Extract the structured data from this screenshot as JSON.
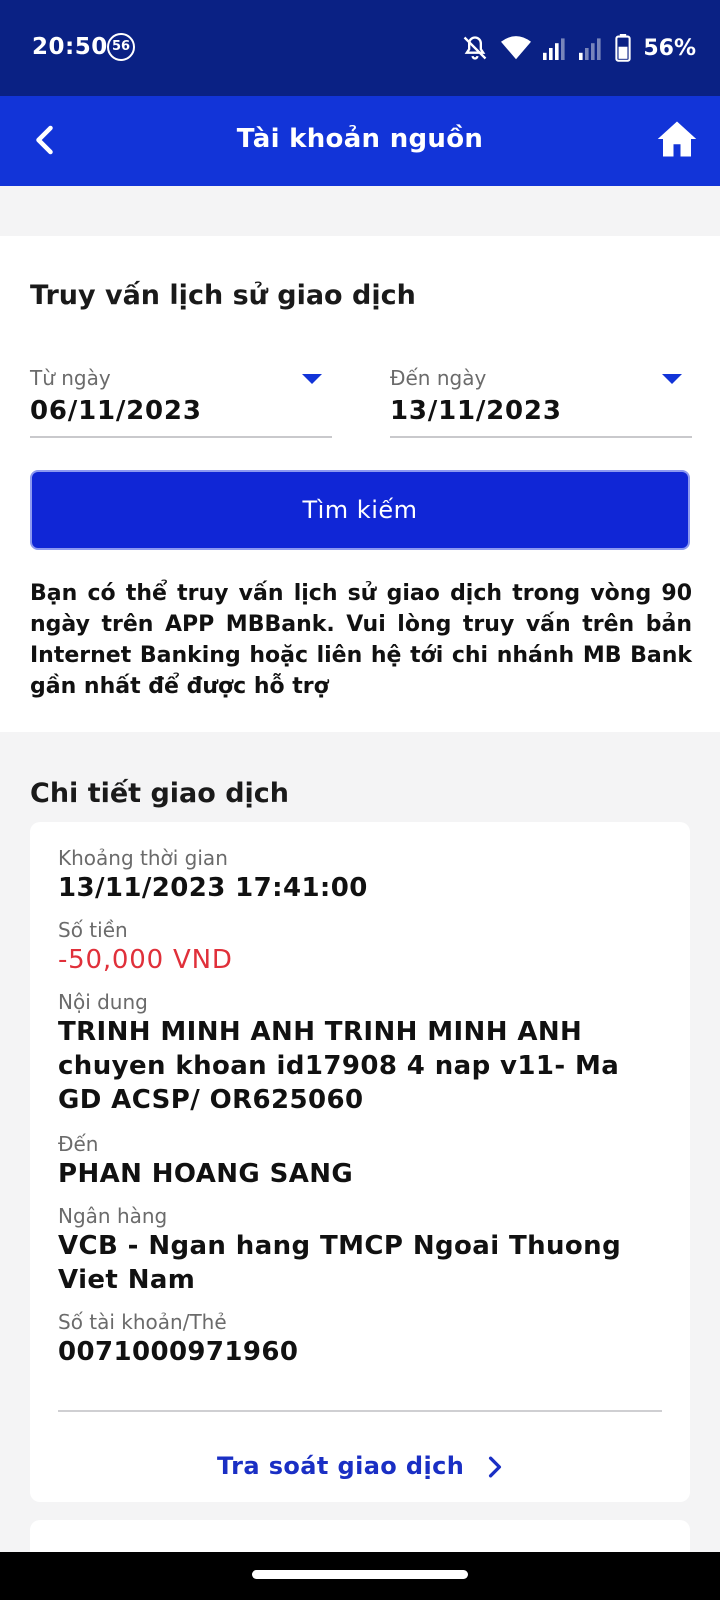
{
  "status_bar": {
    "time": "20:50",
    "notification_badge": "56",
    "battery_percent": "56%",
    "icons": [
      "notifications-off-icon",
      "wifi-icon",
      "signal-icon",
      "signal-icon",
      "battery-icon"
    ]
  },
  "header": {
    "title": "Tài khoản nguồn",
    "back_icon": "chevron-left-icon",
    "home_icon": "home-icon"
  },
  "query": {
    "title": "Truy vấn lịch sử giao dịch",
    "from_label": "Từ ngày",
    "from_value": "06/11/2023",
    "to_label": "Đến ngày",
    "to_value": "13/11/2023",
    "search_label": "Tìm kiếm",
    "notice": "Bạn có thể truy vấn lịch sử giao dịch trong vòng 90 ngày trên APP MBBank. Vui lòng truy vấn trên bản Internet Banking hoặc liên hệ tới chi nhánh MB Bank gần nhất để được hỗ trợ"
  },
  "details": {
    "section_title": "Chi tiết giao dịch",
    "time_label": "Khoảng thời gian",
    "time_value": "13/11/2023 17:41:00",
    "amount_label": "Số tiền",
    "amount_value": "-50,000 VND",
    "content_label": "Nội dung",
    "content_value": "TRINH MINH ANH TRINH MINH ANH chuyen khoan id17908 4 nap v11- Ma GD ACSP/ OR625060",
    "to_label": "Đến",
    "to_value": "PHAN HOANG SANG",
    "bank_label": "Ngân hàng",
    "bank_value": "VCB - Ngan hang TMCP Ngoai Thuong Viet Nam",
    "account_label": "Số tài khoản/Thẻ",
    "account_value": "0071000971960",
    "trace_label": "Tra soát giao dịch"
  },
  "colors": {
    "status_bar": "#0a2184",
    "header": "#1234d8",
    "button": "#1026d6",
    "amount_negative": "#e0303a",
    "link": "#1a2fc4"
  }
}
